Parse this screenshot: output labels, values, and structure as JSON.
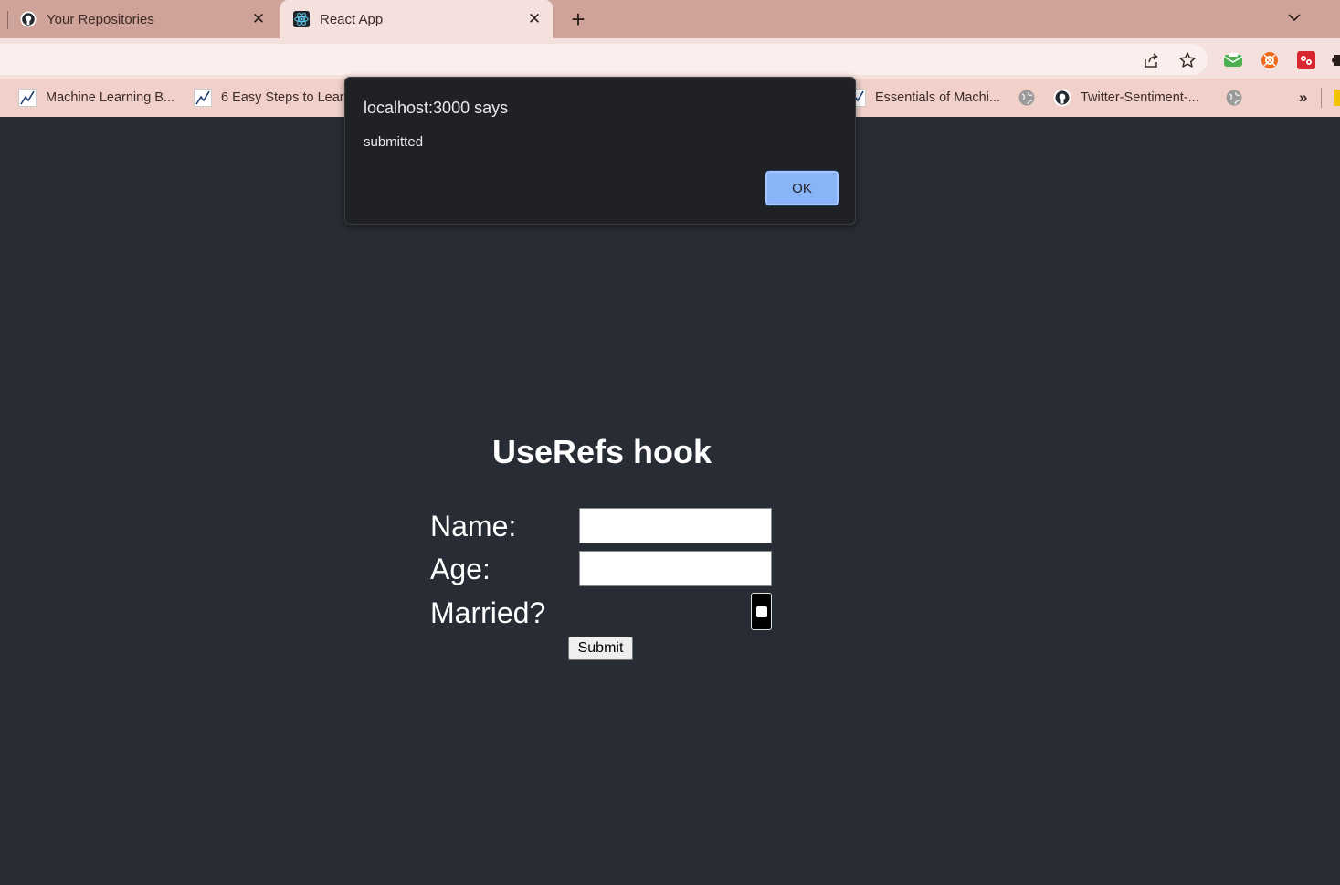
{
  "browser": {
    "tabs": [
      {
        "title": "Your Repositories",
        "active": false,
        "icon": "github-icon"
      },
      {
        "title": "React App",
        "active": true,
        "icon": "react-icon"
      }
    ],
    "new_tab_symbol": "+",
    "close_symbol": "✕"
  },
  "bookmarks": {
    "items": [
      {
        "label": "Machine Learning B..."
      },
      {
        "label": "6 Easy Steps to Lear..."
      },
      {
        "label": "Essentials of Machi..."
      },
      {
        "label": "Twitter-Sentiment-..."
      }
    ],
    "overflow_symbol": "»"
  },
  "dialog": {
    "title": "localhost:3000 says",
    "message": "submitted",
    "ok_label": "OK"
  },
  "app": {
    "heading": "UseRefs hook",
    "form": {
      "name_label": "Name:",
      "name_value": "",
      "age_label": "Age:",
      "age_value": "",
      "married_label": "Married?",
      "married_checked": false,
      "submit_label": "Submit"
    }
  },
  "colors": {
    "page_background": "#282c34",
    "tab_strip": "#cfa39a",
    "active_tab": "#f4e1dd",
    "dialog_background": "#202124",
    "ok_button": "#8ab4f8"
  }
}
